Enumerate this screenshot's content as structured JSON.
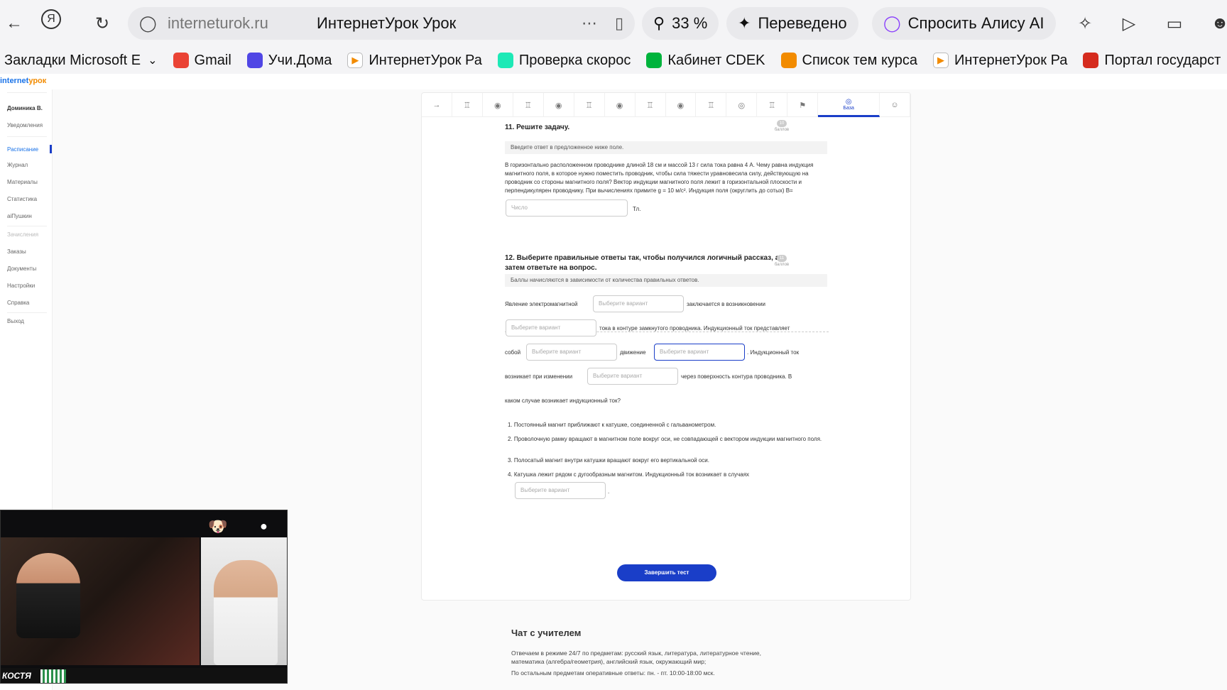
{
  "browser": {
    "domain": "interneturok.ru",
    "page_title": "ИнтернетУрок Урок",
    "zoom": "33 %",
    "translated_label": "Переведено",
    "alice_label": "Спросить Алису AI"
  },
  "bookmarks": [
    {
      "label": "Закладки Microsoft E",
      "color": "#ffffff"
    },
    {
      "label": "Gmail",
      "color": "#ea4335"
    },
    {
      "label": "Учи.Дома",
      "color": "#5046e5"
    },
    {
      "label": "ИнтернетУрок Ра",
      "color": "#ffffff"
    },
    {
      "label": "Проверка скорос",
      "color": "#1de9b6"
    },
    {
      "label": "Кабинет CDEK",
      "color": "#00b33c"
    },
    {
      "label": "Список тем курса",
      "color": "#f28b00"
    },
    {
      "label": "ИнтернетУрок Ра",
      "color": "#ffffff"
    },
    {
      "label": "Портал государст",
      "color": "#d52b1e"
    }
  ],
  "site": {
    "logo_a": "internet",
    "logo_b": "урок"
  },
  "sidebar": {
    "user": "Доминика В.",
    "items": [
      "Уведомления",
      "Расписание",
      "Журнал",
      "Материалы",
      "Статистика",
      "аiПушкин",
      "Зачисления",
      "Заказы",
      "Документы",
      "Настройки",
      "Справка",
      "Выход"
    ]
  },
  "qnav": {
    "base_label": "База",
    "icons": [
      "→",
      "♖",
      "◉",
      "♖",
      "◉",
      "♖",
      "◉",
      "♖",
      "◉",
      "♖",
      "◎",
      "♖",
      "⚑"
    ],
    "end_icon": "☺"
  },
  "q11": {
    "title": "11. Решите задачу.",
    "score_num": "10",
    "score_label": "баллов",
    "hint": "Введите ответ в предложенное ниже поле.",
    "text": "В горизонтально расположенном проводнике длиной 18 см и массой 13 г сила тока равна 4 А. Чему равна индукция магнитного поля, в которое нужно поместить проводник, чтобы сила тяжести уравновесила силу, действующую на проводник со стороны магнитного поля? Вектор индукции магнитного поля лежит в горизонтальной плоскости и перпендикулярен проводнику. При вычислениях примите g = 10 м/с². Индукция поля (округлить до сотых) B=",
    "input_placeholder": "Число",
    "unit": "Тл."
  },
  "q12": {
    "title_line1": "12. Выберите правильные ответы так, чтобы получился логичный рассказ, а",
    "title_line2": "затем ответьте на вопрос.",
    "score_num": "11",
    "score_label": "баллов",
    "hint": "Баллы начисляются в зависимости от количества правильных ответов.",
    "select_placeholder": "Выберите вариант",
    "t1": "Явление электромагнитной",
    "t2": "заключается в возникновении",
    "t3": "тока в контуре замкнутого проводника. Индукционный ток представляет",
    "t4": "собой",
    "t5": "движение",
    "t6": ". Индукционный ток",
    "t7": "возникает при изменении",
    "t8": "через поверхность контура проводника. В",
    "t9": "каком случае возникает индукционный ток?",
    "options": [
      "1. Постоянный магнит приближают к катушке, соединенной с гальванометром.",
      "2. Проволочную рамку вращают в магнитном поле вокруг оси, не совпадающей с вектором индукции магнитного поля.",
      "3. Полосатый магнит внутри катушки вращают вокруг его вертикальной оси.",
      "4. Катушка лежит рядом с дугообразным магнитом. Индукционный ток возникает в случаях"
    ],
    "end_dot": "."
  },
  "submit_label": "Завершить тест",
  "chat": {
    "title": "Чат с учителем",
    "line1": "Отвечаем в режиме 24/7 по предметам: русский язык, литература, литературное чтение,",
    "line2": "математика (алгебра/геометрия), английский язык, окружающий мир;",
    "line3": "По остальным предметам оперативные ответы: пн. - пт. 10:00-18:00 мск."
  },
  "video": {
    "logo_text": "КОСТЯ"
  }
}
